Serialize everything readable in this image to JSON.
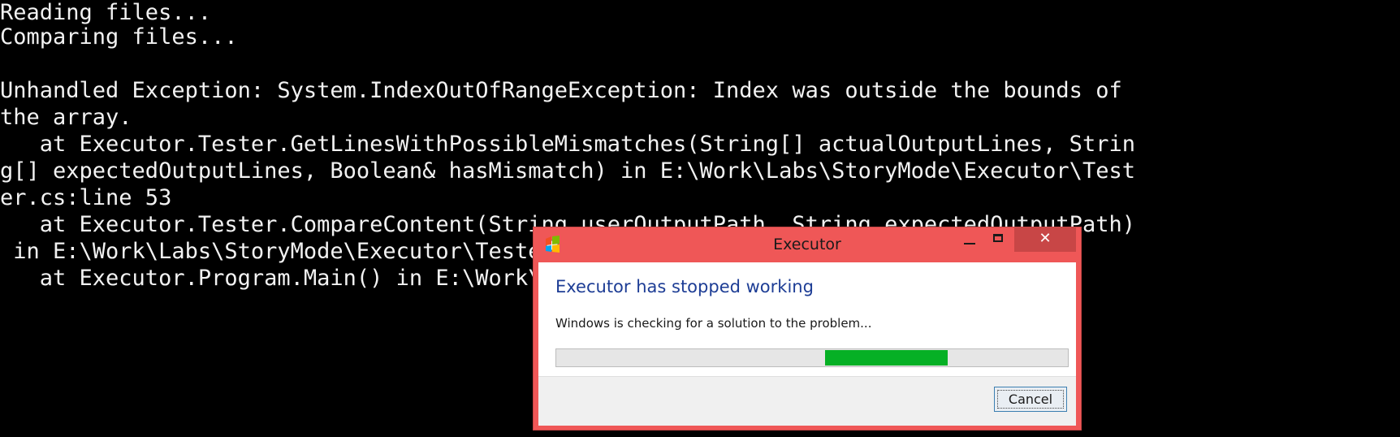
{
  "console": {
    "lines": [
      "Reading files...",
      "Comparing files...",
      "",
      "Unhandled Exception: System.IndexOutOfRangeException: Index was outside the bounds of",
      "the array.",
      "   at Executor.Tester.GetLinesWithPossibleMismatches(String[] actualOutputLines, Strin",
      "g[] expectedOutputLines, Boolean& hasMismatch) in E:\\Work\\Labs\\StoryMode\\Executor\\Test",
      "er.cs:line 53",
      "   at Executor.Tester.CompareContent(String userOutputPath, String expectedOutputPath)",
      " in E:\\Work\\Labs\\StoryMode\\Executor\\Tester.cs:line 16",
      "   at Executor.Program.Main() in E:\\Work\\Labs\\StoryMode\\Executor\\Program.cs:line 7"
    ]
  },
  "dialog": {
    "title": "Executor",
    "heading": "Executor has stopped working",
    "message": "Windows is checking for a solution to the problem...",
    "cancel_label": "Cancel",
    "progress": {
      "track_start": 0.525,
      "track_length": 0.24,
      "style": "marquee"
    },
    "icons": {
      "app": "error-report-icon",
      "minimize": "minimize-icon",
      "maximize": "maximize-icon",
      "close": "close-icon"
    },
    "colors": {
      "frame": "#ef5757",
      "close_button": "#c84646",
      "heading": "#1d3d95",
      "progress_fill": "#06b025"
    }
  }
}
